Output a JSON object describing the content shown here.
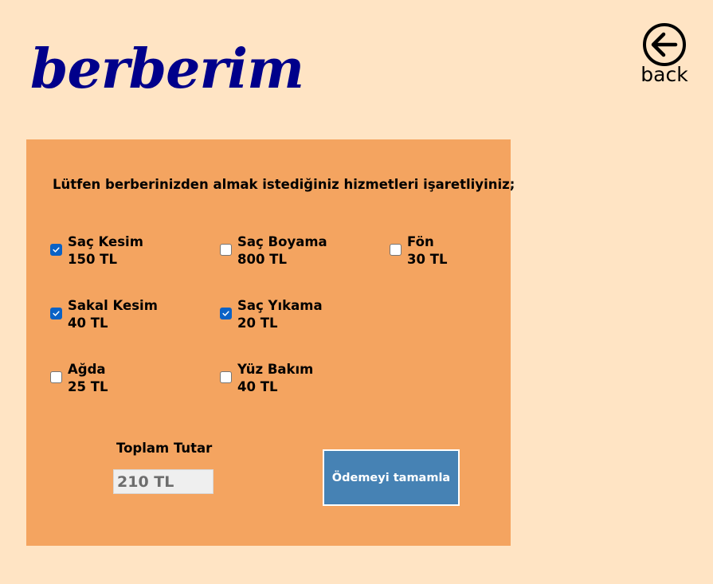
{
  "header": {
    "logo_text": "berberim",
    "back_label": "back",
    "back_icon": "circle-arrow-left-icon"
  },
  "form": {
    "instruction": "Lütfen berberinizden almak istediğiniz hizmetleri işaretliyiniz;",
    "services": [
      {
        "name": "Saç Kesim",
        "price": "150 TL",
        "checked": true
      },
      {
        "name": "Saç Boyama",
        "price": "800 TL",
        "checked": false
      },
      {
        "name": "Fön",
        "price": "30 TL",
        "checked": false
      },
      {
        "name": "Sakal Kesim",
        "price": "40 TL",
        "checked": true
      },
      {
        "name": "Saç Yıkama",
        "price": "20 TL",
        "checked": true
      },
      {
        "name": "Ağda",
        "price": "25 TL",
        "checked": false
      },
      {
        "name": "Yüz Bakım",
        "price": "40 TL",
        "checked": false
      }
    ],
    "total_label": "Toplam Tutar",
    "total_value": "210 TL",
    "pay_button_label": "Ödemeyi tamamla"
  },
  "colors": {
    "page_background": "#ffe4c4",
    "panel_background": "#f4a460",
    "logo_color": "#00008b",
    "button_background": "#4682b4",
    "checkbox_checked": "#0a62c6"
  }
}
